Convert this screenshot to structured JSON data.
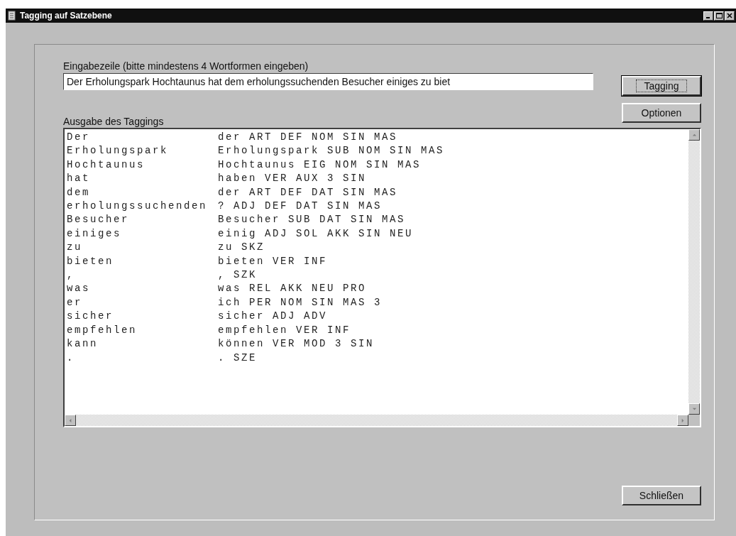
{
  "window": {
    "title": "Tagging auf Satzebene"
  },
  "input": {
    "label": "Eingabezeile (bitte mindestens 4 Wortformen eingeben)",
    "value": "Der Erholungspark Hochtaunus hat dem erholungssuchenden Besucher einiges zu biet"
  },
  "buttons": {
    "tagging": "Tagging",
    "options": "Optionen",
    "close": "Schließen"
  },
  "output": {
    "label": "Ausgabe des Taggings",
    "rows": [
      {
        "word": "Der",
        "tag": "der ART DEF NOM SIN MAS"
      },
      {
        "word": "Erholungspark",
        "tag": "Erholungspark SUB NOM SIN MAS"
      },
      {
        "word": "Hochtaunus",
        "tag": "Hochtaunus EIG NOM SIN MAS"
      },
      {
        "word": "hat",
        "tag": "haben VER AUX 3 SIN"
      },
      {
        "word": "dem",
        "tag": "der ART DEF DAT SIN MAS"
      },
      {
        "word": "erholungssuchenden",
        "tag": "? ADJ DEF DAT SIN MAS"
      },
      {
        "word": "Besucher",
        "tag": "Besucher SUB DAT SIN MAS"
      },
      {
        "word": "einiges",
        "tag": "einig ADJ SOL AKK SIN NEU"
      },
      {
        "word": "zu",
        "tag": "zu SKZ"
      },
      {
        "word": "bieten",
        "tag": "bieten VER INF"
      },
      {
        "word": ",",
        "tag": ", SZK"
      },
      {
        "word": "was",
        "tag": "was REL AKK NEU PRO"
      },
      {
        "word": "er",
        "tag": "ich PER NOM SIN MAS 3"
      },
      {
        "word": "sicher",
        "tag": "sicher ADJ ADV"
      },
      {
        "word": "empfehlen",
        "tag": "empfehlen VER INF"
      },
      {
        "word": "kann",
        "tag": "können VER MOD 3 SIN"
      },
      {
        "word": ".",
        "tag": ". SZE"
      }
    ]
  }
}
